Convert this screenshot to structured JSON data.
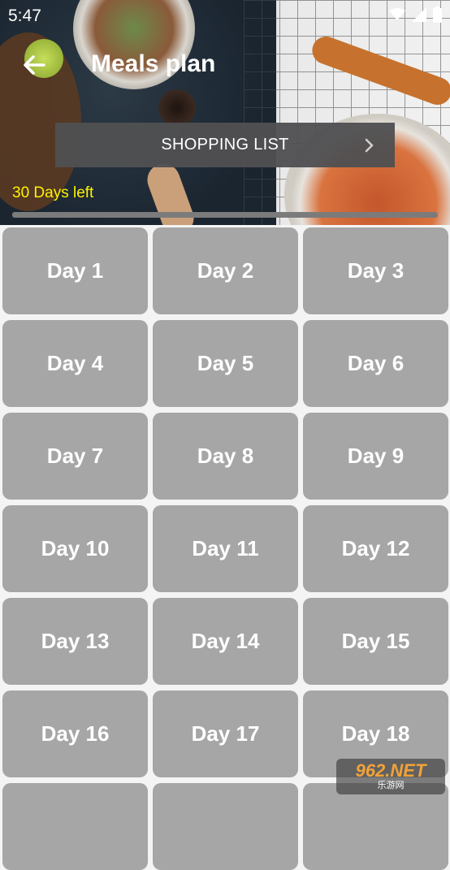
{
  "status_bar": {
    "time": "5:47"
  },
  "header": {
    "title": "Meals plan",
    "back_icon": "arrow-left-icon"
  },
  "shopping_list": {
    "label": "SHOPPING LIST",
    "icon": "chevron-right-icon"
  },
  "progress": {
    "days_left_text": "30 Days left",
    "fraction": 0.0
  },
  "days": [
    "Day 1",
    "Day 2",
    "Day 3",
    "Day 4",
    "Day 5",
    "Day 6",
    "Day 7",
    "Day 8",
    "Day 9",
    "Day 10",
    "Day 11",
    "Day 12",
    "Day 13",
    "Day 14",
    "Day 15",
    "Day 16",
    "Day 17",
    "Day 18",
    "",
    "",
    ""
  ],
  "watermark": {
    "top": "962.NET",
    "bottom": "乐游网"
  },
  "colors": {
    "day_tile": "#a6a6a6",
    "days_left": "#fff200",
    "button_bg": "#505052"
  }
}
